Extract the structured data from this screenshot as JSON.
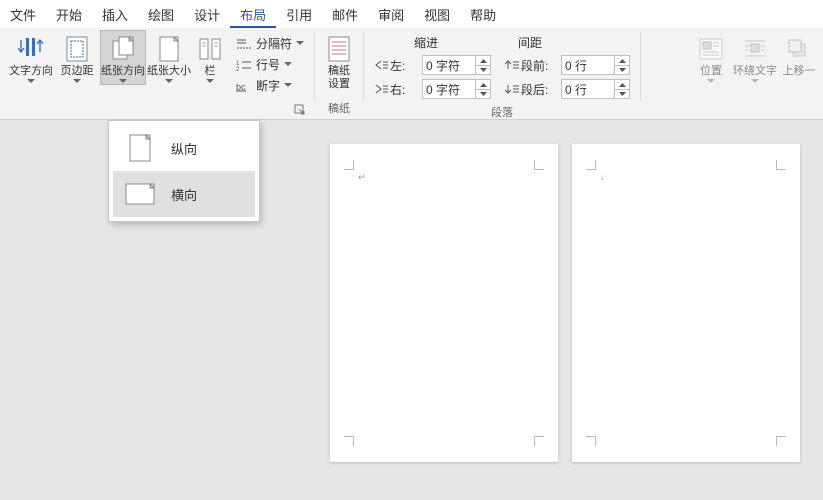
{
  "tabs": {
    "file": "文件",
    "home": "开始",
    "insert": "插入",
    "draw": "绘图",
    "design": "设计",
    "layout": "布局",
    "references": "引用",
    "mailings": "邮件",
    "review": "审阅",
    "view": "视图",
    "help": "帮助"
  },
  "ribbon": {
    "text_direction": "文字方向",
    "margins": "页边距",
    "orientation": "纸张方向",
    "size": "纸张大小",
    "columns": "栏",
    "breaks": "分隔符",
    "line_numbers": "行号",
    "hyphenation": "断字",
    "manuscript": "稿纸\n设置",
    "indent_head": "缩进",
    "spacing_head": "间距",
    "left_label": "左:",
    "right_label": "右:",
    "before_label": "段前:",
    "after_label": "段后:",
    "left_val": "0 字符",
    "right_val": "0 字符",
    "before_val": "0 行",
    "after_val": "0 行",
    "group_manuscript": "稿纸",
    "group_paragraph": "段落",
    "position": "位置",
    "wrap_text": "环绕文字",
    "bring_forward": "上移一"
  },
  "dropdown": {
    "portrait": "纵向",
    "landscape": "横向"
  }
}
